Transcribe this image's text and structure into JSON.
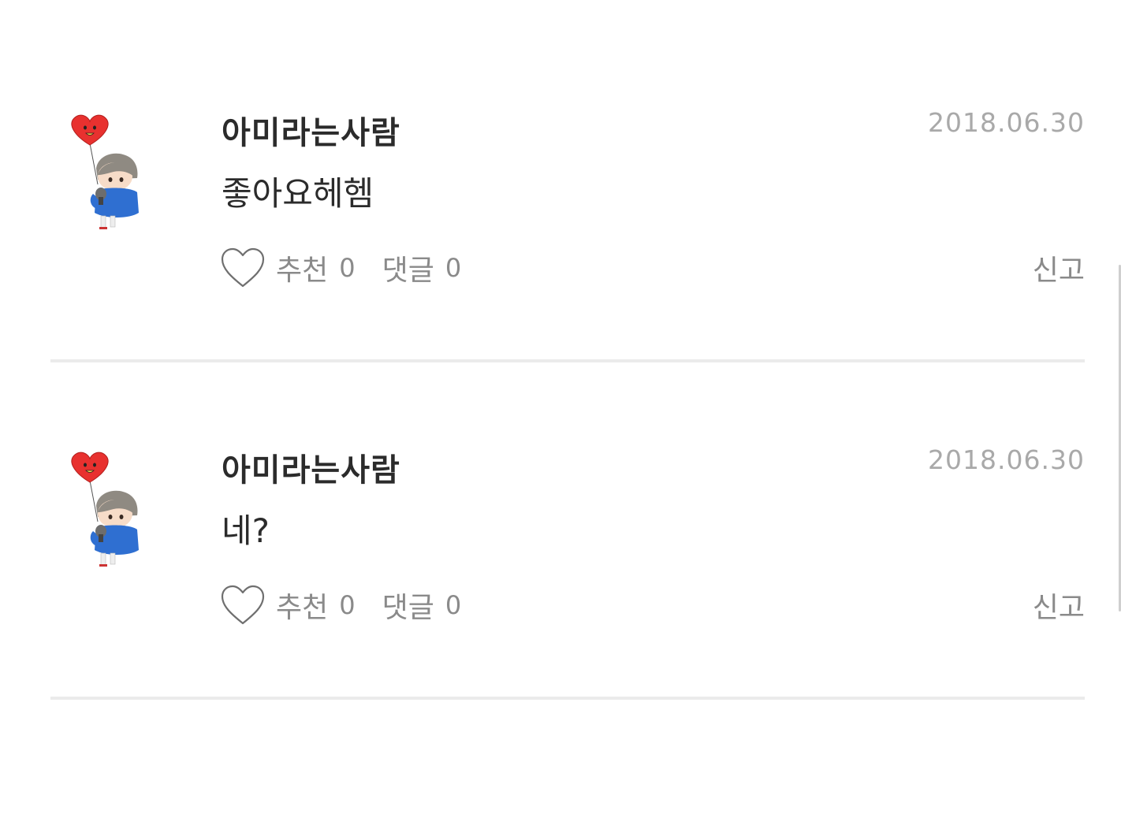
{
  "comments": [
    {
      "username": "아미라는사람",
      "date": "2018.06.30",
      "text": "좋아요헤헴",
      "like_label": "추천",
      "like_count": "0",
      "reply_label": "댓글",
      "reply_count": "0",
      "report_label": "신고",
      "avatar_icon": "chibi-character-with-heart-balloon-icon"
    },
    {
      "username": "아미라는사람",
      "date": "2018.06.30",
      "text": "네?",
      "like_label": "추천",
      "like_count": "0",
      "reply_label": "댓글",
      "reply_count": "0",
      "report_label": "신고",
      "avatar_icon": "chibi-character-with-heart-balloon-icon"
    }
  ],
  "colors": {
    "text_primary": "#2b2b2b",
    "text_secondary": "#8a8a8a",
    "date": "#a9a9a9",
    "divider": "#ebebeb",
    "balloon_red": "#e8312f",
    "hoodie_blue": "#2f6fd1",
    "hair_gray": "#8f8a82"
  }
}
